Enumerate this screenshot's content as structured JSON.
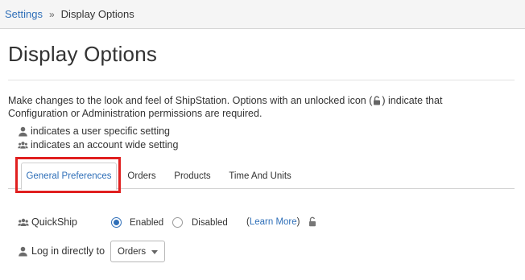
{
  "breadcrumb": {
    "parent": "Settings",
    "separator": "»",
    "current": "Display Options"
  },
  "page": {
    "title": "Display Options",
    "intro_part1": "Make changes to the look and feel of ShipStation. Options with an unlocked icon (",
    "intro_part2": ") indicate that",
    "intro_line2": "Configuration or Administration permissions are required."
  },
  "legend": {
    "user_text": "indicates a user specific setting",
    "account_text": "indicates an account wide setting"
  },
  "tabs": [
    {
      "label": "General Preferences",
      "active": true
    },
    {
      "label": "Orders",
      "active": false
    },
    {
      "label": "Products",
      "active": false
    },
    {
      "label": "Time And Units",
      "active": false
    }
  ],
  "quickship": {
    "label": "QuickShip",
    "enabled_label": "Enabled",
    "disabled_label": "Disabled",
    "selected": "Enabled",
    "open_paren": "(",
    "learn_more": "Learn More",
    "close_paren": ")"
  },
  "login": {
    "label": "Log in directly to",
    "selected": "Orders"
  },
  "icons": {
    "user": "user-icon",
    "account": "users-icon",
    "unlocked": "unlocked-icon"
  },
  "colors": {
    "link": "#2f6fb8",
    "highlight": "#e02020"
  }
}
